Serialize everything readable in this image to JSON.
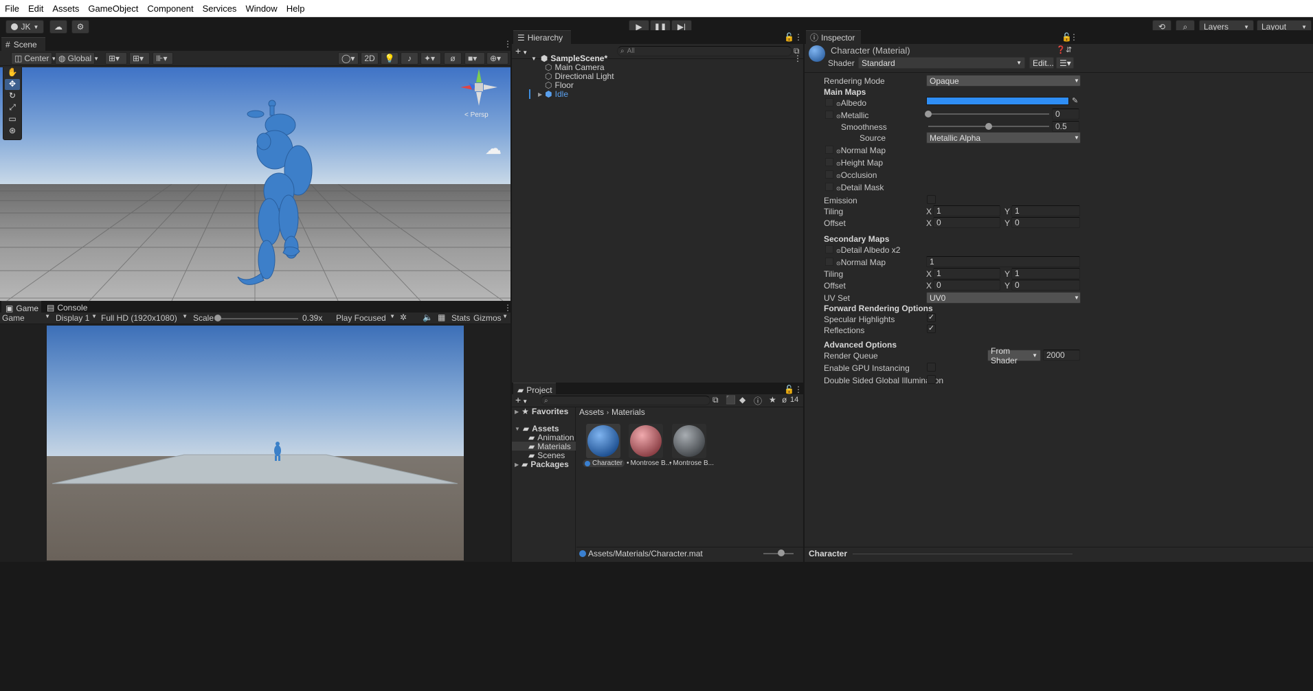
{
  "menubar": [
    "File",
    "Edit",
    "Assets",
    "GameObject",
    "Component",
    "Services",
    "Window",
    "Help"
  ],
  "toolbar": {
    "account": "JK",
    "layers": "Layers",
    "layout": "Layout"
  },
  "scene": {
    "tab": "Scene",
    "pivot": "Center",
    "space": "Global",
    "mode_2d": "2D",
    "view_label": "< Persp"
  },
  "game": {
    "tab_game": "Game",
    "tab_console": "Console",
    "mode": "Game",
    "display": "Display 1",
    "resolution": "Full HD (1920x1080)",
    "scale_label": "Scale",
    "scale_value": "0.39x",
    "scale_fraction": 0.0,
    "play_mode": "Play Focused",
    "stats": "Stats",
    "gizmos": "Gizmos"
  },
  "hierarchy": {
    "tab": "Hierarchy",
    "search_placeholder": "All",
    "scene_name": "SampleScene*",
    "items": [
      "Main Camera",
      "Directional Light",
      "Floor",
      "Idle"
    ]
  },
  "project": {
    "tab": "Project",
    "count": "14",
    "favorites": "Favorites",
    "assets": "Assets",
    "folders": [
      "Animation",
      "Materials",
      "Scenes"
    ],
    "packages": "Packages",
    "breadcrumb": [
      "Assets",
      "Materials"
    ],
    "materials": [
      {
        "label": "Character",
        "color": "#2f6fc0"
      },
      {
        "label": "Montrose B...",
        "color": "#c06a6f"
      },
      {
        "label": "Montrose B...",
        "color": "#6f7378"
      }
    ],
    "path": "Assets/Materials/Character.mat"
  },
  "inspector": {
    "tab": "Inspector",
    "title": "Character (Material)",
    "shader_label": "Shader",
    "shader": "Standard",
    "edit": "Edit...",
    "rendering_mode_label": "Rendering Mode",
    "rendering_mode": "Opaque",
    "main_maps": "Main Maps",
    "albedo": "Albedo",
    "albedo_color": "#2f8ef5",
    "metallic": "Metallic",
    "metallic_value": "0",
    "metallic_fraction": 0.0,
    "smoothness": "Smoothness",
    "smoothness_value": "0.5",
    "smoothness_fraction": 0.5,
    "source": "Source",
    "source_value": "Metallic Alpha",
    "normal_map": "Normal Map",
    "height_map": "Height Map",
    "occlusion": "Occlusion",
    "detail_mask": "Detail Mask",
    "emission": "Emission",
    "tiling": "Tiling",
    "offset": "Offset",
    "x": "X",
    "y": "Y",
    "tiling_x": "1",
    "tiling_y": "1",
    "offset_x": "0",
    "offset_y": "0",
    "secondary_maps": "Secondary Maps",
    "detail_albedo": "Detail Albedo x2",
    "normal_map2": "Normal Map",
    "normal_map2_value": "1",
    "tiling2_x": "1",
    "tiling2_y": "1",
    "offset2_x": "0",
    "offset2_y": "0",
    "uv_set": "UV Set",
    "uv_set_value": "UV0",
    "forward_options": "Forward Rendering Options",
    "specular": "Specular Highlights",
    "reflections": "Reflections",
    "advanced": "Advanced Options",
    "render_queue": "Render Queue",
    "render_queue_mode": "From Shader",
    "render_queue_value": "2000",
    "gpu_instancing": "Enable GPU Instancing",
    "double_sided": "Double Sided Global Illumination",
    "preview_label": "Character"
  }
}
